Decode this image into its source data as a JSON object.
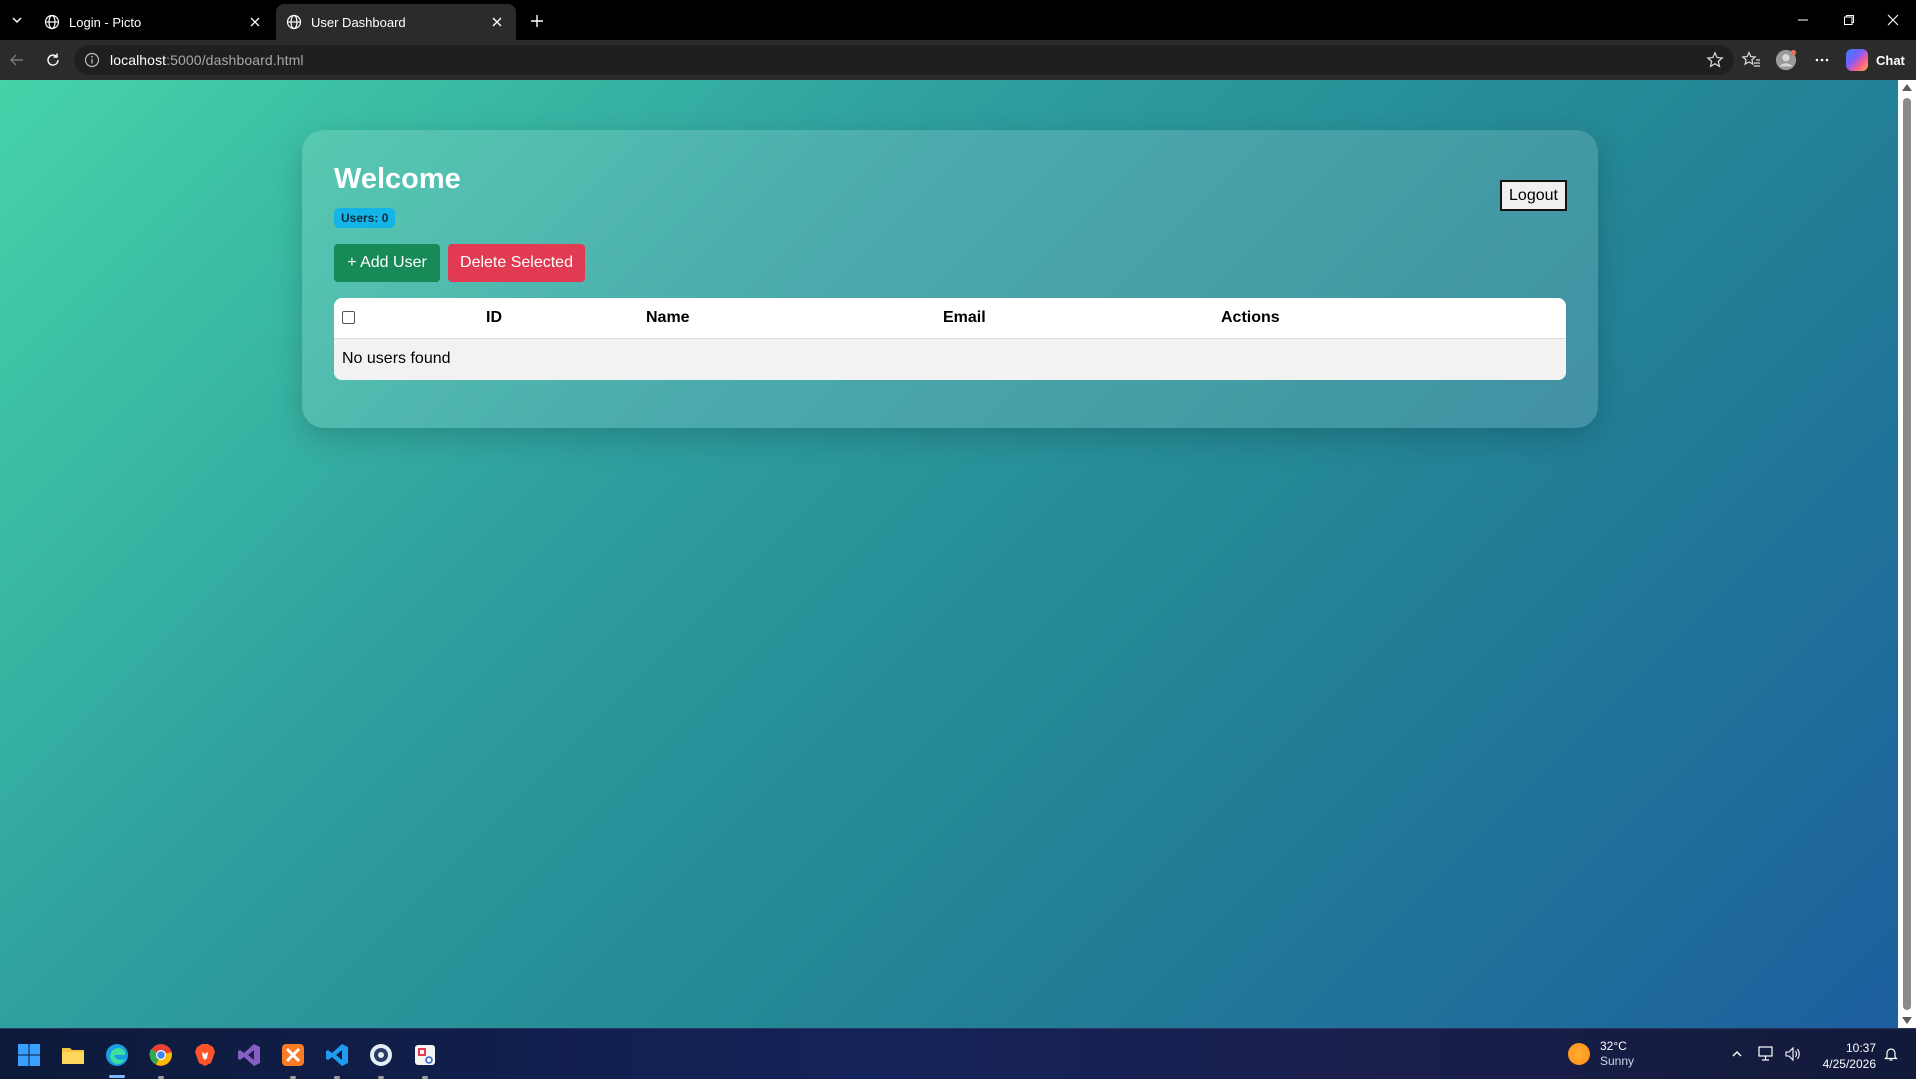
{
  "browser": {
    "tabs": [
      {
        "title": "Login - Picto",
        "active": false
      },
      {
        "title": "User Dashboard",
        "active": true
      }
    ],
    "url_host": "localhost",
    "url_path": ":5000/dashboard.html",
    "chat_label": "Chat"
  },
  "page": {
    "title": "Welcome",
    "user_count_label": "Users: 0",
    "logout_label": "Logout",
    "add_user_label": "+ Add User",
    "delete_selected_label": "Delete Selected",
    "table": {
      "columns": [
        "ID",
        "Name",
        "Email",
        "Actions"
      ],
      "empty_message": "No users found"
    }
  },
  "taskbar": {
    "weather": {
      "temp": "32°C",
      "condition": "Sunny"
    },
    "clock": {
      "time": "10:37",
      "date": "4/25/2026"
    }
  },
  "colors": {
    "add_button": "#178a57",
    "delete_button": "#e23a52",
    "badge": "#13b5e8"
  }
}
